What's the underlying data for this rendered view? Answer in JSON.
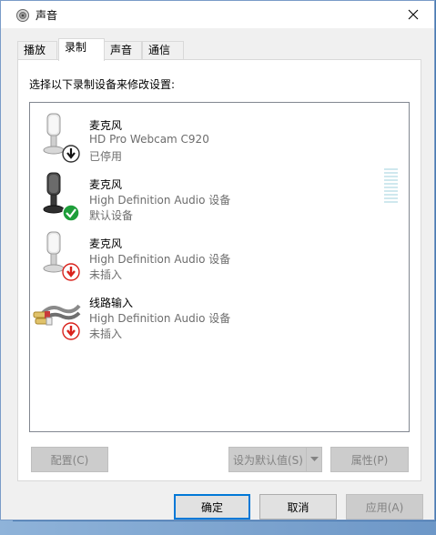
{
  "window": {
    "title": "声音",
    "close_label": "✕"
  },
  "tabs": [
    {
      "label": "播放"
    },
    {
      "label": "录制"
    },
    {
      "label": "声音"
    },
    {
      "label": "通信"
    }
  ],
  "active_tab": "录制",
  "panel": {
    "instruction": "选择以下录制设备来修改设置:"
  },
  "devices": [
    {
      "name": "麦克风",
      "description": "HD Pro Webcam C920",
      "status": "已停用",
      "icon": "webcam-microphone-icon",
      "badge": "disabled-down-arrow-icon"
    },
    {
      "name": "麦克风",
      "description": "High Definition Audio 设备",
      "status": "默认设备",
      "icon": "microphone-icon",
      "badge": "default-check-icon"
    },
    {
      "name": "麦克风",
      "description": "High Definition Audio 设备",
      "status": "未插入",
      "icon": "microphone-icon",
      "badge": "unplugged-down-arrow-icon"
    },
    {
      "name": "线路输入",
      "description": "High Definition Audio 设备",
      "status": "未插入",
      "icon": "line-in-cable-icon",
      "badge": "unplugged-down-arrow-icon"
    }
  ],
  "panel_buttons": {
    "configure": "配置(C)",
    "set_default": "设为默认值(S)",
    "properties": "属性(P)"
  },
  "dialog_buttons": {
    "ok": "确定",
    "cancel": "取消",
    "apply": "应用(A)"
  },
  "colors": {
    "accent": "#0078d7",
    "default_badge": "#1e9e3a",
    "unplugged_badge": "#d9221c"
  }
}
